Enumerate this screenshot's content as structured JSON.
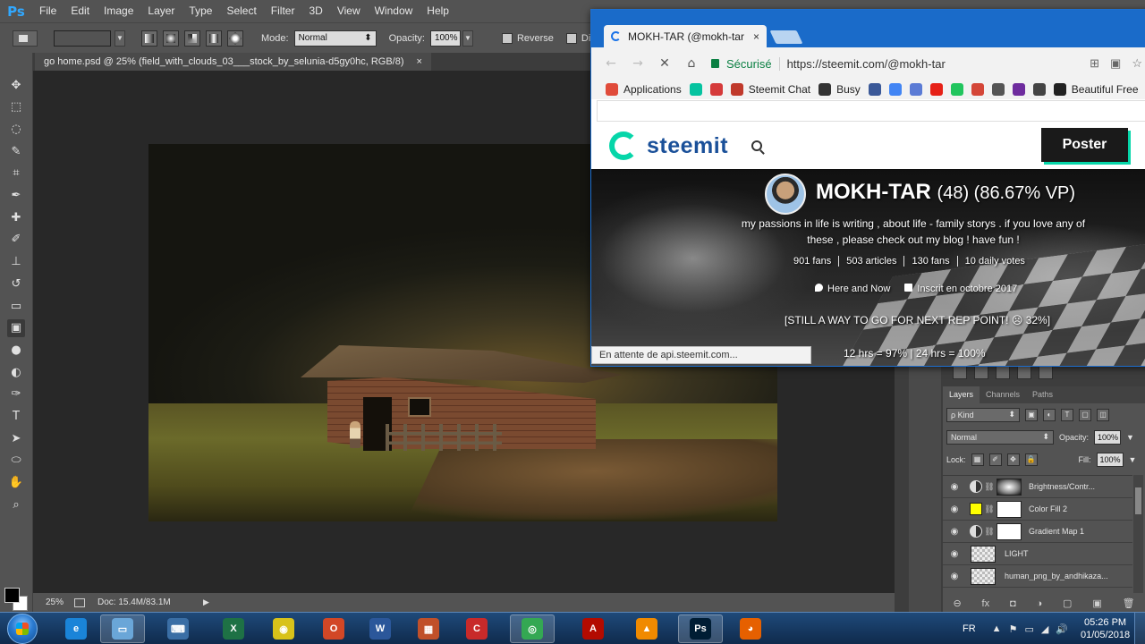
{
  "ps": {
    "logo": "Ps",
    "menu": [
      "File",
      "Edit",
      "Image",
      "Layer",
      "Type",
      "Select",
      "Filter",
      "3D",
      "View",
      "Window",
      "Help"
    ],
    "options": {
      "mode_label": "Mode:",
      "mode_value": "Normal",
      "opacity_label": "Opacity:",
      "opacity_value": "100%",
      "reverse_label": "Reverse",
      "dither_label": "Dither"
    },
    "document_tab": {
      "title": "go home.psd @ 25% (field_with_clouds_03___stock_by_selunia-d5gy0hc, RGB/8)",
      "close": "×"
    },
    "status": {
      "zoom": "25%",
      "doc_info": "Doc: 15.4M/83.1M",
      "arrow": "▶"
    },
    "tools": [
      {
        "name": "move-tool",
        "glyph": "✥"
      },
      {
        "name": "marquee-tool",
        "glyph": "⬚"
      },
      {
        "name": "lasso-tool",
        "glyph": "◌"
      },
      {
        "name": "quick-select-tool",
        "glyph": "✎"
      },
      {
        "name": "crop-tool",
        "glyph": "⌗"
      },
      {
        "name": "eyedropper-tool",
        "glyph": "✒"
      },
      {
        "name": "healing-brush-tool",
        "glyph": "✚"
      },
      {
        "name": "brush-tool",
        "glyph": "✐"
      },
      {
        "name": "clone-stamp-tool",
        "glyph": "⊥"
      },
      {
        "name": "history-brush-tool",
        "glyph": "↺"
      },
      {
        "name": "eraser-tool",
        "glyph": "▭"
      },
      {
        "name": "gradient-tool",
        "glyph": "▣"
      },
      {
        "name": "blur-tool",
        "glyph": "●"
      },
      {
        "name": "dodge-tool",
        "glyph": "◐"
      },
      {
        "name": "pen-tool",
        "glyph": "✑"
      },
      {
        "name": "type-tool",
        "glyph": "T"
      },
      {
        "name": "path-select-tool",
        "glyph": "➤"
      },
      {
        "name": "shape-tool",
        "glyph": "⬭"
      },
      {
        "name": "hand-tool",
        "glyph": "✋"
      },
      {
        "name": "zoom-tool",
        "glyph": "⌕"
      }
    ],
    "dock_tab_top": "",
    "layers_panel": {
      "tabs": [
        "Layers",
        "Channels",
        "Paths"
      ],
      "kind_label": "ρ Kind",
      "blend_value": "Normal",
      "opacity_label": "Opacity:",
      "opacity_value": "100%",
      "lock_label": "Lock:",
      "fill_label": "Fill:",
      "fill_value": "100%",
      "layers": [
        {
          "name": "Brightness/Contr...",
          "kind": "adjustment",
          "mask": "gradient"
        },
        {
          "name": "Color Fill 2",
          "kind": "fill",
          "mask": "white"
        },
        {
          "name": "Gradient Map 1",
          "kind": "adjustment",
          "mask": "white"
        },
        {
          "name": "LIGHT",
          "kind": "pixel",
          "mask": "none"
        },
        {
          "name": "human_png_by_andhikaza...",
          "kind": "pixel",
          "mask": "none"
        }
      ],
      "footer_icons": [
        "⊖",
        "fx",
        "◘",
        "◑",
        "▢",
        "▣",
        "🗑"
      ]
    }
  },
  "chrome": {
    "tab_title": "MOKH-TAR (@mokh-tar",
    "tab_close": "×",
    "secure_label": "Sécurisé",
    "url": "https://steemit.com/@mokh-tar",
    "bookmarks": [
      {
        "label": "Applications",
        "color": "#e04b3a"
      },
      {
        "label": "",
        "color": "#06c3a0"
      },
      {
        "label": "",
        "color": "#d53a3a"
      },
      {
        "label": "Steemit Chat",
        "color": "#c0392b"
      },
      {
        "label": "Busy",
        "color": "#333333"
      },
      {
        "label": "",
        "color": "#3b5998"
      },
      {
        "label": "",
        "color": "#4285f4"
      },
      {
        "label": "",
        "color": "#5b7bd5"
      },
      {
        "label": "",
        "color": "#e62117"
      },
      {
        "label": "",
        "color": "#22c55e"
      },
      {
        "label": "",
        "color": "#d44638"
      },
      {
        "label": "",
        "color": "#555555"
      },
      {
        "label": "",
        "color": "#6e2c9e"
      },
      {
        "label": "",
        "color": "#444444"
      },
      {
        "label": "Beautiful Free",
        "color": "#222222"
      }
    ],
    "status_bubble": "En attente de api.steemit.com..."
  },
  "steemit": {
    "wordmark": "steemit",
    "post_button": "Poster",
    "profile": {
      "name": "MOKH-TAR",
      "reputation": "(48) (86.67% VP)",
      "bio": "my passions in life is writing , about life - family storys . if you love any of these , please check out my blog ! have fun !",
      "stats": [
        "901 fans",
        "503 articles",
        "130 fans",
        "10 daily votes"
      ],
      "location": "Here and Now",
      "joined": "Inscrit en octobre 2017",
      "rep_progress": "[STILL A WAY TO GO FOR NEXT REP POINT! ☹ 32%]",
      "vp_recharge": "12 hrs = 97% | 24 hrs = 100%"
    }
  },
  "taskbar": {
    "apps": [
      {
        "name": "ie-icon",
        "color": "#1a84d8",
        "glyph": "e"
      },
      {
        "name": "window-app-icon",
        "color": "#6aa6d8",
        "glyph": "▭"
      },
      {
        "name": "keyboard-app-icon",
        "color": "#3a6ea5",
        "glyph": "⌨"
      },
      {
        "name": "excel-icon",
        "color": "#1e7145",
        "glyph": "X"
      },
      {
        "name": "disc-app-icon",
        "color": "#d8c21a",
        "glyph": "◉"
      },
      {
        "name": "office-app-icon",
        "color": "#d24726",
        "glyph": "O"
      },
      {
        "name": "word-icon",
        "color": "#2b579a",
        "glyph": "W"
      },
      {
        "name": "archive-app-icon",
        "color": "#c0502a",
        "glyph": "▦"
      },
      {
        "name": "ccleaner-icon",
        "color": "#c82a2a",
        "glyph": "C"
      },
      {
        "name": "chrome-icon",
        "color": "#34a853",
        "glyph": "◎"
      },
      {
        "name": "acrobat-icon",
        "color": "#b30b00",
        "glyph": "A"
      },
      {
        "name": "vlc-icon",
        "color": "#f08a00",
        "glyph": "▲"
      },
      {
        "name": "photoshop-icon",
        "color": "#001d34",
        "glyph": "Ps"
      },
      {
        "name": "firefox-icon",
        "color": "#e66000",
        "glyph": "◕"
      }
    ],
    "language": "FR",
    "tray_icons": [
      "▲",
      "⚑",
      "▭",
      "◢",
      "🔊"
    ],
    "time": "05:26 PM",
    "date": "01/05/2018"
  }
}
